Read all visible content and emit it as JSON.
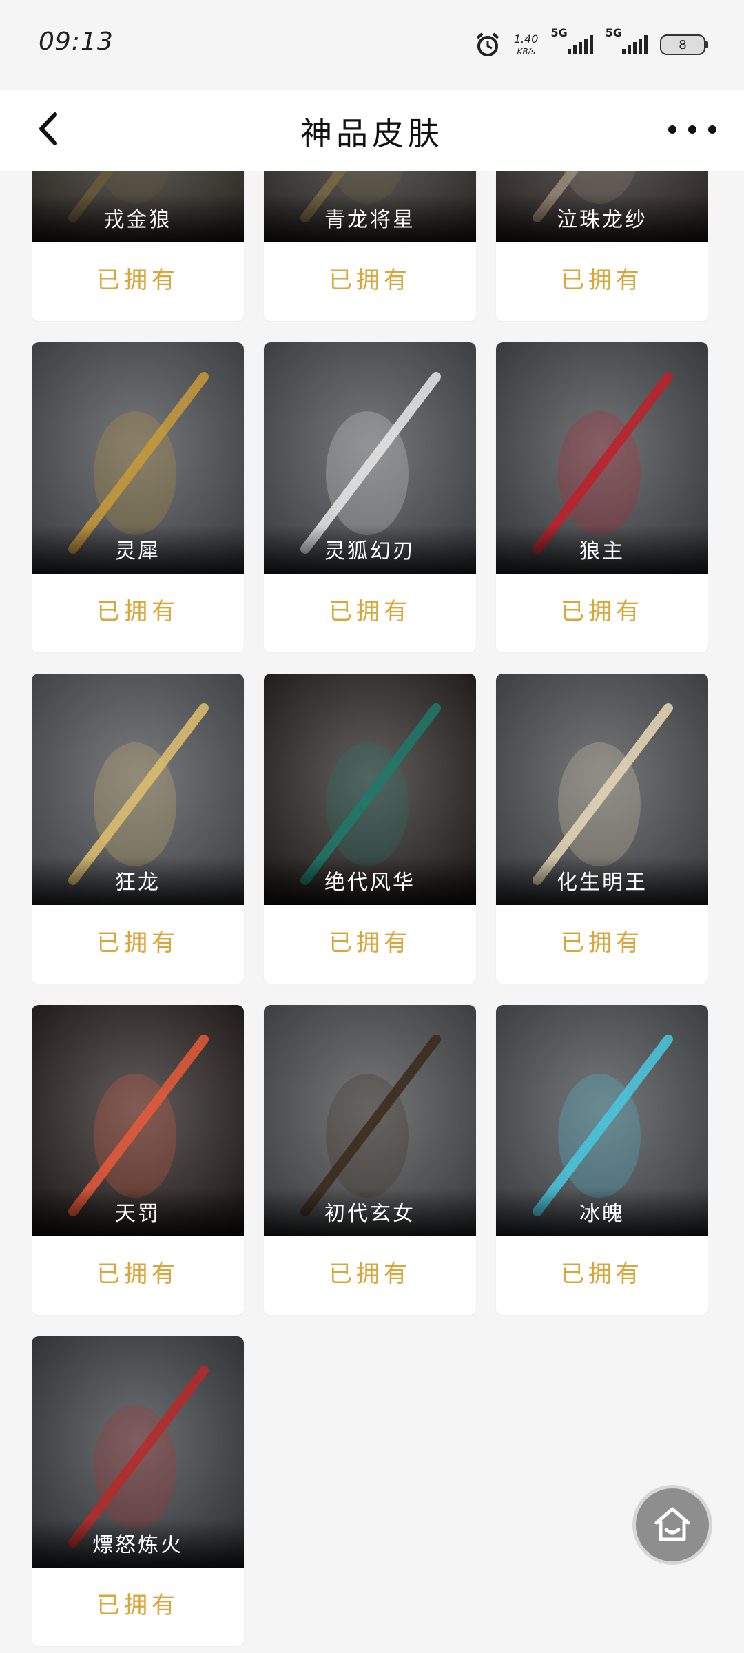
{
  "status_bar": {
    "time": "09:13",
    "net_speed": "1.40",
    "net_unit": "KB/s",
    "sim1": "5G",
    "sim2": "5G",
    "battery": "8"
  },
  "header": {
    "title": "神品皮肤",
    "back_icon": "chevron-left-icon",
    "more_icon": "more-horizontal-icon"
  },
  "owned_label": "已拥有",
  "items": [
    {
      "name": "戎金狼",
      "status": "已拥有",
      "palette": [
        "#2a2620",
        "#6a5a3a"
      ]
    },
    {
      "name": "青龙将星",
      "status": "已拥有",
      "palette": [
        "#2a2824",
        "#7a6a44"
      ]
    },
    {
      "name": "泣珠龙纱",
      "status": "已拥有",
      "palette": [
        "#2a2422",
        "#9a8a7a"
      ]
    },
    {
      "name": "灵犀",
      "status": "已拥有",
      "palette": [
        "#3a3d40",
        "#c89a3a"
      ]
    },
    {
      "name": "灵狐幻刃",
      "status": "已拥有",
      "palette": [
        "#3a3d40",
        "#e8e8e8"
      ]
    },
    {
      "name": "狼主",
      "status": "已拥有",
      "palette": [
        "#35383b",
        "#c0202a"
      ]
    },
    {
      "name": "狂龙",
      "status": "已拥有",
      "palette": [
        "#3e4144",
        "#e0c070"
      ]
    },
    {
      "name": "绝代风华",
      "status": "已拥有",
      "palette": [
        "#1e1a18",
        "#1e7a6a"
      ]
    },
    {
      "name": "化生明王",
      "status": "已拥有",
      "palette": [
        "#3a3c3e",
        "#e8d8b8"
      ]
    },
    {
      "name": "天罚",
      "status": "已拥有",
      "palette": [
        "#1e1816",
        "#e85a3a"
      ]
    },
    {
      "name": "初代玄女",
      "status": "已拥有",
      "palette": [
        "#3a3c3e",
        "#3a2a1a"
      ]
    },
    {
      "name": "冰魄",
      "status": "已拥有",
      "palette": [
        "#3a3d40",
        "#4ac8e0"
      ]
    },
    {
      "name": "熛怒炼火",
      "status": "已拥有",
      "palette": [
        "#2e3134",
        "#b82a2a"
      ]
    }
  ],
  "home_button_icon": "home-icon"
}
